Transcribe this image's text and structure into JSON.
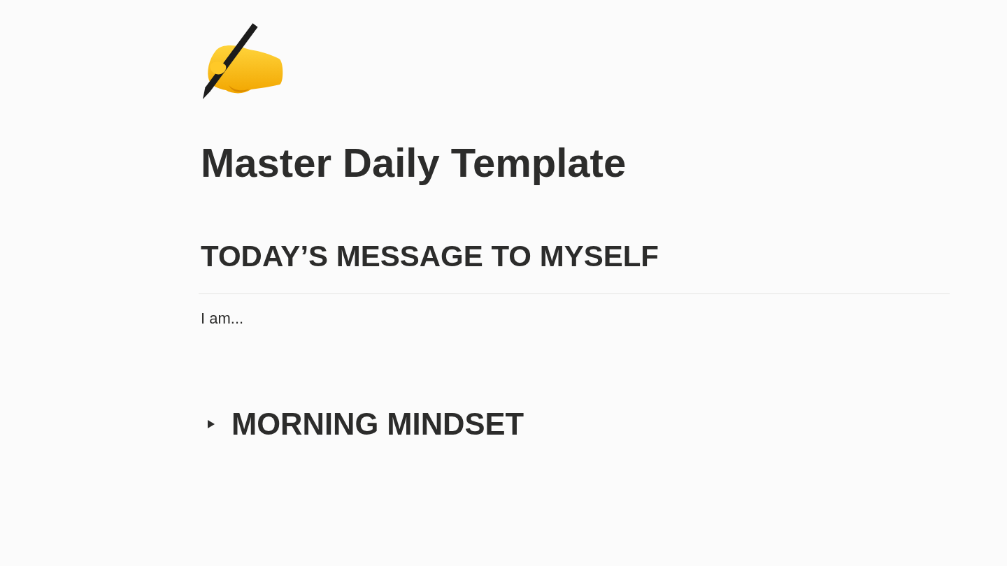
{
  "page": {
    "title": "Master Daily Template"
  },
  "blocks": [
    {
      "kind": "heading",
      "text": "TODAY’S MESSAGE TO MYSELF"
    },
    {
      "kind": "divider"
    },
    {
      "kind": "text",
      "text": "I am..."
    },
    {
      "kind": "spacer"
    },
    {
      "kind": "toggle",
      "text": "MORNING MINDSET",
      "expanded": false
    }
  ]
}
